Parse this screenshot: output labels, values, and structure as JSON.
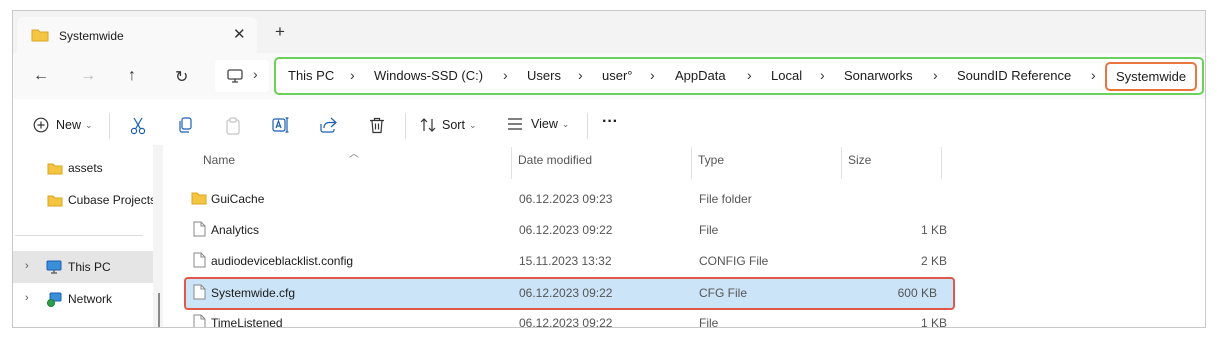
{
  "window": {
    "tab_title": "Systemwide",
    "tab_close": "✕",
    "new_tab": "+"
  },
  "nav": {
    "back": "←",
    "forward": "→",
    "up": "↑",
    "refresh": "↻",
    "monitor_chevron": "›"
  },
  "breadcrumbs": [
    "This PC",
    "Windows-SSD (C:)",
    "Users",
    "user°",
    "AppData",
    "Local",
    "Sonarworks",
    "SoundID Reference",
    "Systemwide"
  ],
  "breadcrumb_separator": "›",
  "commands": {
    "new_label": "New",
    "sort_label": "Sort",
    "view_label": "View",
    "more_label": "···"
  },
  "sidebar": {
    "items": [
      {
        "label": "assets"
      },
      {
        "label": "Cubase Projects"
      },
      {
        "label": "This PC"
      },
      {
        "label": "Network"
      }
    ],
    "expand_arrow": "›"
  },
  "columns": {
    "name": "Name",
    "date": "Date modified",
    "type": "Type",
    "size": "Size"
  },
  "files": [
    {
      "name": "GuiCache",
      "date": "06.12.2023 09:23",
      "type": "File folder",
      "size": "",
      "icon": "folder-icon"
    },
    {
      "name": "Analytics",
      "date": "06.12.2023 09:22",
      "type": "File",
      "size": "1 KB",
      "icon": "file-icon"
    },
    {
      "name": "audiodeviceblacklist.config",
      "date": "15.11.2023 13:32",
      "type": "CONFIG File",
      "size": "2 KB",
      "icon": "file-icon"
    },
    {
      "name": "Systemwide.cfg",
      "date": "06.12.2023 09:22",
      "type": "CFG File",
      "size": "600 KB",
      "icon": "file-icon"
    },
    {
      "name": "TimeListened",
      "date": "06.12.2023 09:22",
      "type": "File",
      "size": "1 KB",
      "icon": "file-icon"
    }
  ],
  "colors": {
    "address_highlight": "#6ad25c",
    "current_crumb_highlight": "#e8763e",
    "selected_row_border": "#e0584a",
    "selected_row_bg": "#cce4f7",
    "folder_yellow": "#f4c542"
  }
}
